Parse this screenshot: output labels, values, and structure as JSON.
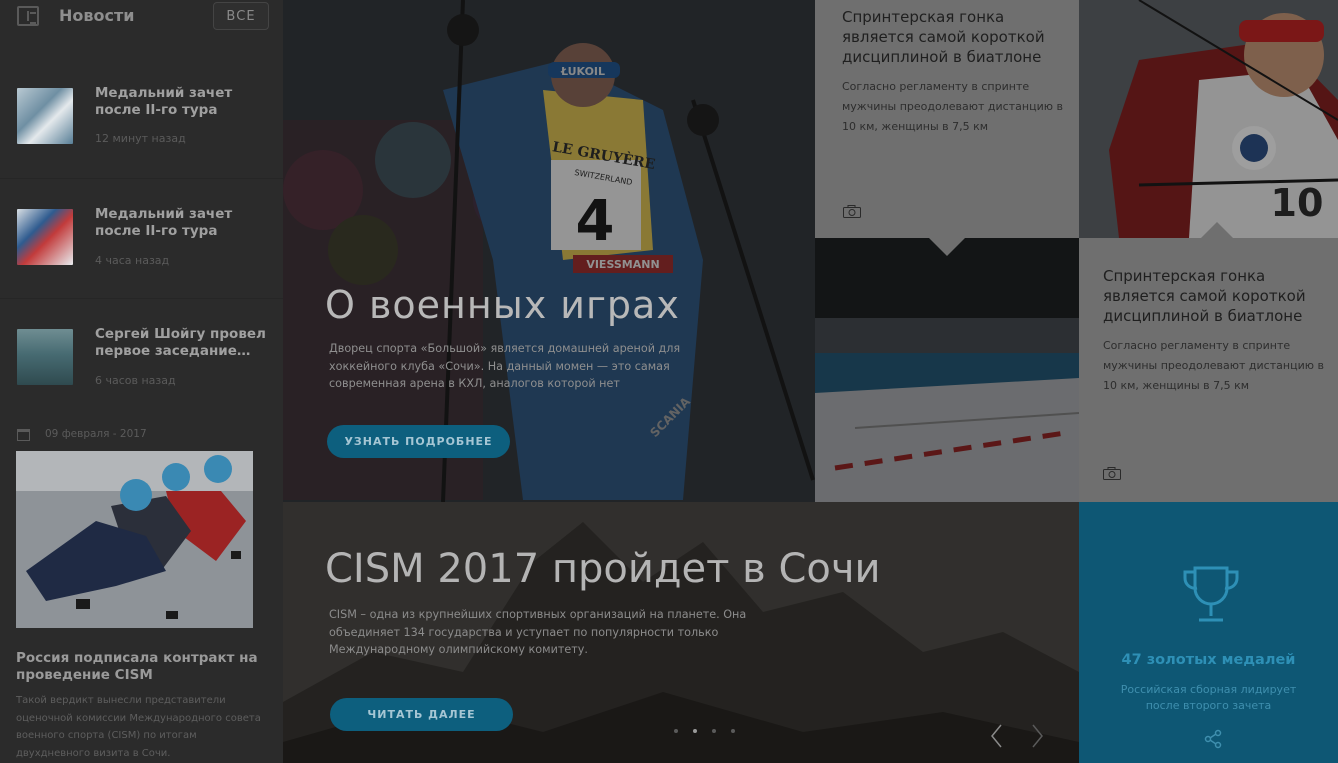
{
  "sidebar": {
    "title": "Новости",
    "all_label": "ВСЕ",
    "items": [
      {
        "title": "Медальний зачет после II-го тура",
        "time": "12 минут назад"
      },
      {
        "title": "Медальний зачет после II-го тура",
        "time": "4 часа назад"
      },
      {
        "title": "Сергей Шойгу провел первое заседание…",
        "time": "6 часов назад"
      }
    ],
    "date": "09 февраля - 2017",
    "feature": {
      "title": "Россия подписала контракт на проведение CISM",
      "text": "Такой вердикт вынесли представители оценочной комиссии Международного совета военного спорта (CISM) по итогам двухдневного визита в Сочи."
    }
  },
  "hero1": {
    "title": "О военных играх",
    "text": "Дворец спорта «Большой» является домашней ареной для хоккейного клуба «Сочи». На данный момен — это самая современная арена в КХЛ, аналогов которой нет",
    "button": "УЗНАТЬ ПОДРОБНЕЕ",
    "photo_text": {
      "bib": "4",
      "sponsor": "LE GRUYÈRE",
      "sponsor2": "SWITZERLAND",
      "cap": "ŁUKOIL",
      "brand": "VIESSMANN",
      "scania": "SCANIA"
    }
  },
  "hero2": {
    "title": "CISM 2017 пройдет в Сочи",
    "text": "CISM – одна из крупнейших спортивных организаций на планете. Она объединяет 134 государства и уступает по популярности только Международному олимпийскому комитету.",
    "button": "ЧИТАТЬ ДАЛЕЕ",
    "dots": 4,
    "active_dot": 2
  },
  "card1": {
    "title": "Спринтерская гонка является самой короткой дисциплиной в биатлоне",
    "text": "Согласно регламенту в спринте мужчины преодолевают дистанцию в 10 км, женщины в 7,5 км"
  },
  "card2": {
    "title": "Спринтерская гонка является самой короткой дисциплиной в биатлоне",
    "text": "Согласно регламенту в спринте мужчины преодолевают дистанцию в 10 км, женщины в 7,5 км"
  },
  "photo_tiles": {
    "bib_number": "10"
  },
  "stat": {
    "value": "47 золотых медалей",
    "text": "Российская сборная лидирует после второго зачета"
  },
  "colors": {
    "accent": "#0e5774",
    "button": "#0d5f7e",
    "card": "#6f6f6f",
    "sidebar": "#2b2b2b"
  }
}
